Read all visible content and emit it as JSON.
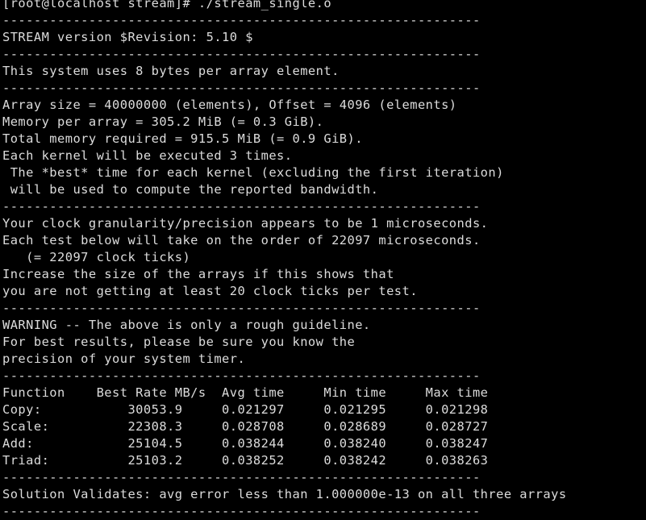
{
  "terminal": {
    "lines": [
      "[root@localhost stream]# ./stream_single.o",
      "-------------------------------------------------------------",
      "STREAM version $Revision: 5.10 $",
      "-------------------------------------------------------------",
      "This system uses 8 bytes per array element.",
      "-------------------------------------------------------------",
      "Array size = 40000000 (elements), Offset = 4096 (elements)",
      "Memory per array = 305.2 MiB (= 0.3 GiB).",
      "Total memory required = 915.5 MiB (= 0.9 GiB).",
      "Each kernel will be executed 3 times.",
      " The *best* time for each kernel (excluding the first iteration)",
      " will be used to compute the reported bandwidth.",
      "-------------------------------------------------------------",
      "Your clock granularity/precision appears to be 1 microseconds.",
      "Each test below will take on the order of 22097 microseconds.",
      "   (= 22097 clock ticks)",
      "Increase the size of the arrays if this shows that",
      "you are not getting at least 20 clock ticks per test.",
      "-------------------------------------------------------------",
      "WARNING -- The above is only a rough guideline.",
      "For best results, please be sure you know the",
      "precision of your system timer.",
      "-------------------------------------------------------------",
      "Function    Best Rate MB/s  Avg time     Min time     Max time",
      "Copy:           30053.9     0.021297     0.021295     0.021298",
      "Scale:          22308.3     0.028708     0.028689     0.028727",
      "Add:            25104.5     0.038244     0.038240     0.038247",
      "Triad:          25103.2     0.038252     0.038242     0.038263",
      "-------------------------------------------------------------",
      "Solution Validates: avg error less than 1.000000e-13 on all three arrays",
      "-------------------------------------------------------------"
    ]
  },
  "colors": {
    "background": "#000000",
    "foreground": "#dcdcdc"
  }
}
